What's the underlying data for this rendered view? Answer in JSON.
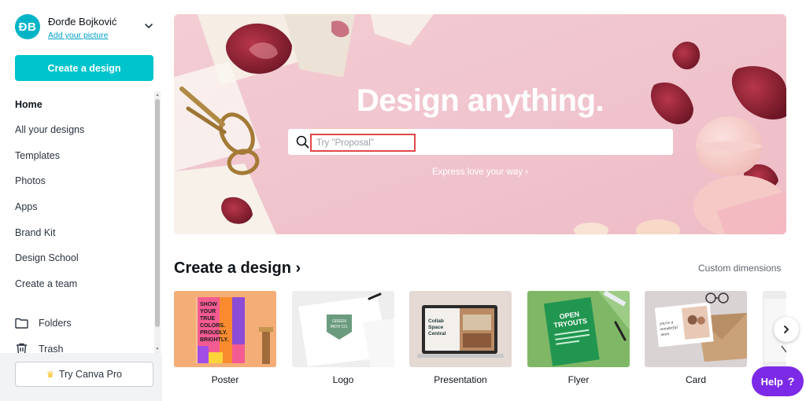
{
  "user": {
    "initials": "ĐB",
    "name": "Đorđe Bojković",
    "add_picture": "Add your picture"
  },
  "sidebar": {
    "create_label": "Create a design",
    "items": [
      {
        "label": "Home",
        "active": true
      },
      {
        "label": "All your designs"
      },
      {
        "label": "Templates"
      },
      {
        "label": "Photos"
      },
      {
        "label": "Apps"
      },
      {
        "label": "Brand Kit"
      },
      {
        "label": "Design School"
      },
      {
        "label": "Create a team"
      }
    ],
    "folders_label": "Folders",
    "folders_icon": "folder-icon",
    "trash_label": "Trash",
    "trash_icon": "trash-icon",
    "pro_label": "Try Canva Pro",
    "pro_icon": "crown-icon"
  },
  "hero": {
    "title": "Design anything.",
    "search_placeholder": "Try \"Proposal\"",
    "link": "Express love your way ›"
  },
  "section": {
    "title": "Create a design",
    "title_chevron": "›",
    "custom_dimensions": "Custom dimensions",
    "cards": [
      {
        "label": "Poster"
      },
      {
        "label": "Logo"
      },
      {
        "label": "Presentation"
      },
      {
        "label": "Flyer"
      },
      {
        "label": "Card"
      }
    ]
  },
  "thumbnails": {
    "poster_text": [
      "SHOW",
      "YOUR",
      "TRUE",
      "COLORS.",
      "PROUDLY.",
      "BRIGHTLY."
    ],
    "logo_text": [
      "GREEN",
      "PATH CO."
    ],
    "presentation_text": [
      "Collab",
      "Space",
      "Central"
    ],
    "flyer_text": [
      "OPEN",
      "TRYOUTS"
    ],
    "card_text": [
      "you're a",
      "wonderful",
      "mom"
    ]
  },
  "help": {
    "label": "Help",
    "icon": "?"
  },
  "colors": {
    "brand_teal": "#00c4cc",
    "hero_pink": "#f0c6cf",
    "help_purple": "#7d2ae8",
    "highlight_red": "#e04848"
  }
}
